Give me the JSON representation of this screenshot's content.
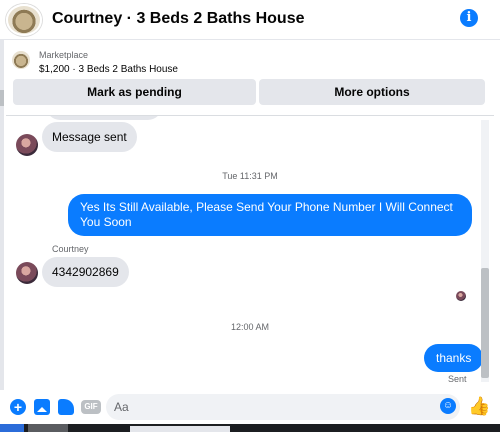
{
  "header": {
    "title": "Courtney · 3 Beds 2 Baths House",
    "info_icon": "info-icon"
  },
  "marketplace": {
    "label": "Marketplace",
    "listing": "$1,200 · 3 Beds 2 Baths House",
    "buttons": {
      "pending": "Mark as pending",
      "more": "More options"
    }
  },
  "thread": {
    "msg_sent": "Message sent",
    "time1": "Tue 11:31 PM",
    "out1": "Yes Its Still Available, Please Send Your Phone Number I Will Connect You Soon",
    "sender_name": "Courtney",
    "in_phone": "4342902869",
    "time2": "12:00 AM",
    "out2": "thanks",
    "sent_status": "Sent"
  },
  "composer": {
    "placeholder": "Aa",
    "gif_label": "GIF",
    "icons": [
      "plus-icon",
      "photo-icon",
      "sticker-icon",
      "gif-icon",
      "emoji-icon",
      "thumbs-up-icon"
    ]
  },
  "colors": {
    "accent": "#0a7cff",
    "bubble_in": "#e4e6eb",
    "muted_text": "#65676b"
  }
}
